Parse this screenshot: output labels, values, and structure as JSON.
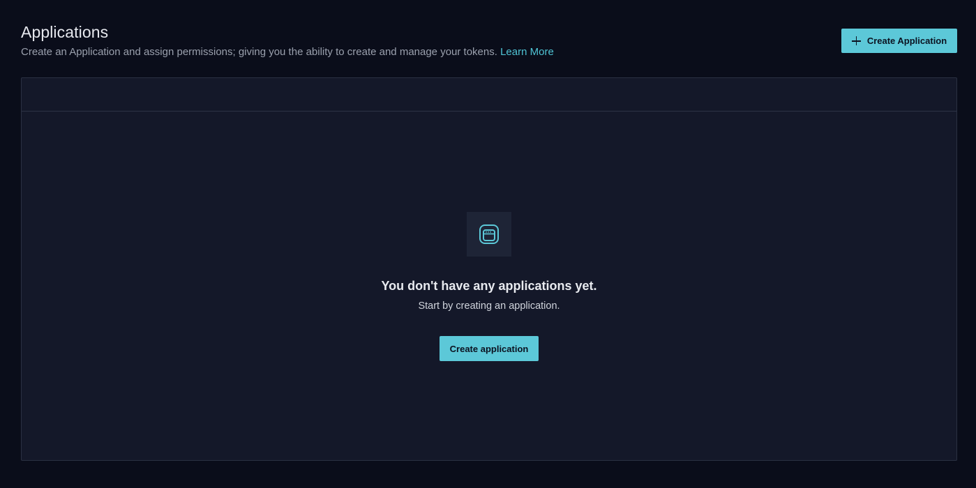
{
  "header": {
    "title": "Applications",
    "subtitle": "Create an Application and assign permissions; giving you the ability to create and manage your tokens.",
    "learn_more": "Learn More",
    "create_button_label": "Create Application",
    "create_button_icon": "plus-icon"
  },
  "empty_state": {
    "icon": "application-window-icon",
    "title": "You don't have any applications yet.",
    "subtitle": "Start by creating an application.",
    "button_label": "Create application"
  },
  "colors": {
    "background": "#0a0d1a",
    "panel": "#141829",
    "accent": "#5cc8d8",
    "link": "#4fc3d4"
  }
}
